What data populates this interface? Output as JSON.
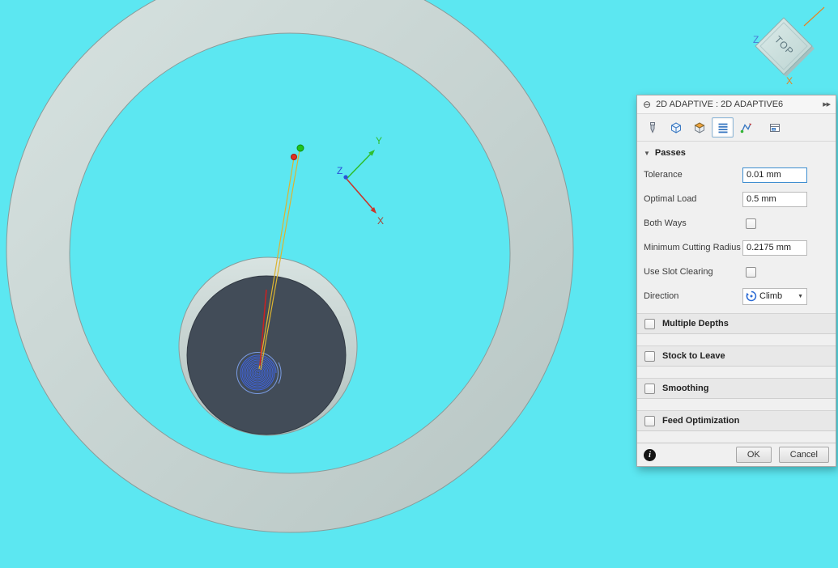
{
  "scene": {
    "background": "#5ce7f1",
    "triad": {
      "x": "X",
      "y": "Y",
      "z": "Z"
    },
    "viewcube": {
      "top": "TOP",
      "z": "Z",
      "x": "X"
    },
    "colors": {
      "toolpath": "#3f63d6",
      "rapid": "#dcb431",
      "plunge": "#cc2020",
      "stock": "#c5d2d0",
      "pocket": "#424c58"
    }
  },
  "dialog": {
    "title": "2D ADAPTIVE : 2D ADAPTIVE6",
    "icons": {
      "collapse": "⊖",
      "forward": "▶▶",
      "passes_triangle": "▼",
      "dropdown_arrow": "▼",
      "info": "i"
    },
    "tabs": [
      {
        "name": "tool"
      },
      {
        "name": "geometry"
      },
      {
        "name": "heights"
      },
      {
        "name": "passes",
        "selected": true
      },
      {
        "name": "linking"
      },
      {
        "name": "options"
      }
    ],
    "passes": {
      "heading": "Passes",
      "rows": [
        {
          "label": "Tolerance",
          "type": "input",
          "value": "0.01 mm"
        },
        {
          "label": "Optimal Load",
          "type": "input",
          "value": "0.5 mm"
        },
        {
          "label": "Both Ways",
          "type": "checkbox",
          "checked": false
        },
        {
          "label": "Minimum Cutting Radius",
          "type": "input",
          "value": "0.2175 mm"
        },
        {
          "label": "Use Slot Clearing",
          "type": "checkbox",
          "checked": false
        },
        {
          "label": "Direction",
          "type": "dropdown",
          "value": "Climb"
        }
      ]
    },
    "sections": [
      {
        "label": "Multiple Depths",
        "checked": false
      },
      {
        "label": "Stock to Leave",
        "checked": false
      },
      {
        "label": "Smoothing",
        "checked": false
      },
      {
        "label": "Feed Optimization",
        "checked": false
      }
    ],
    "footer": {
      "ok": "OK",
      "cancel": "Cancel"
    }
  }
}
